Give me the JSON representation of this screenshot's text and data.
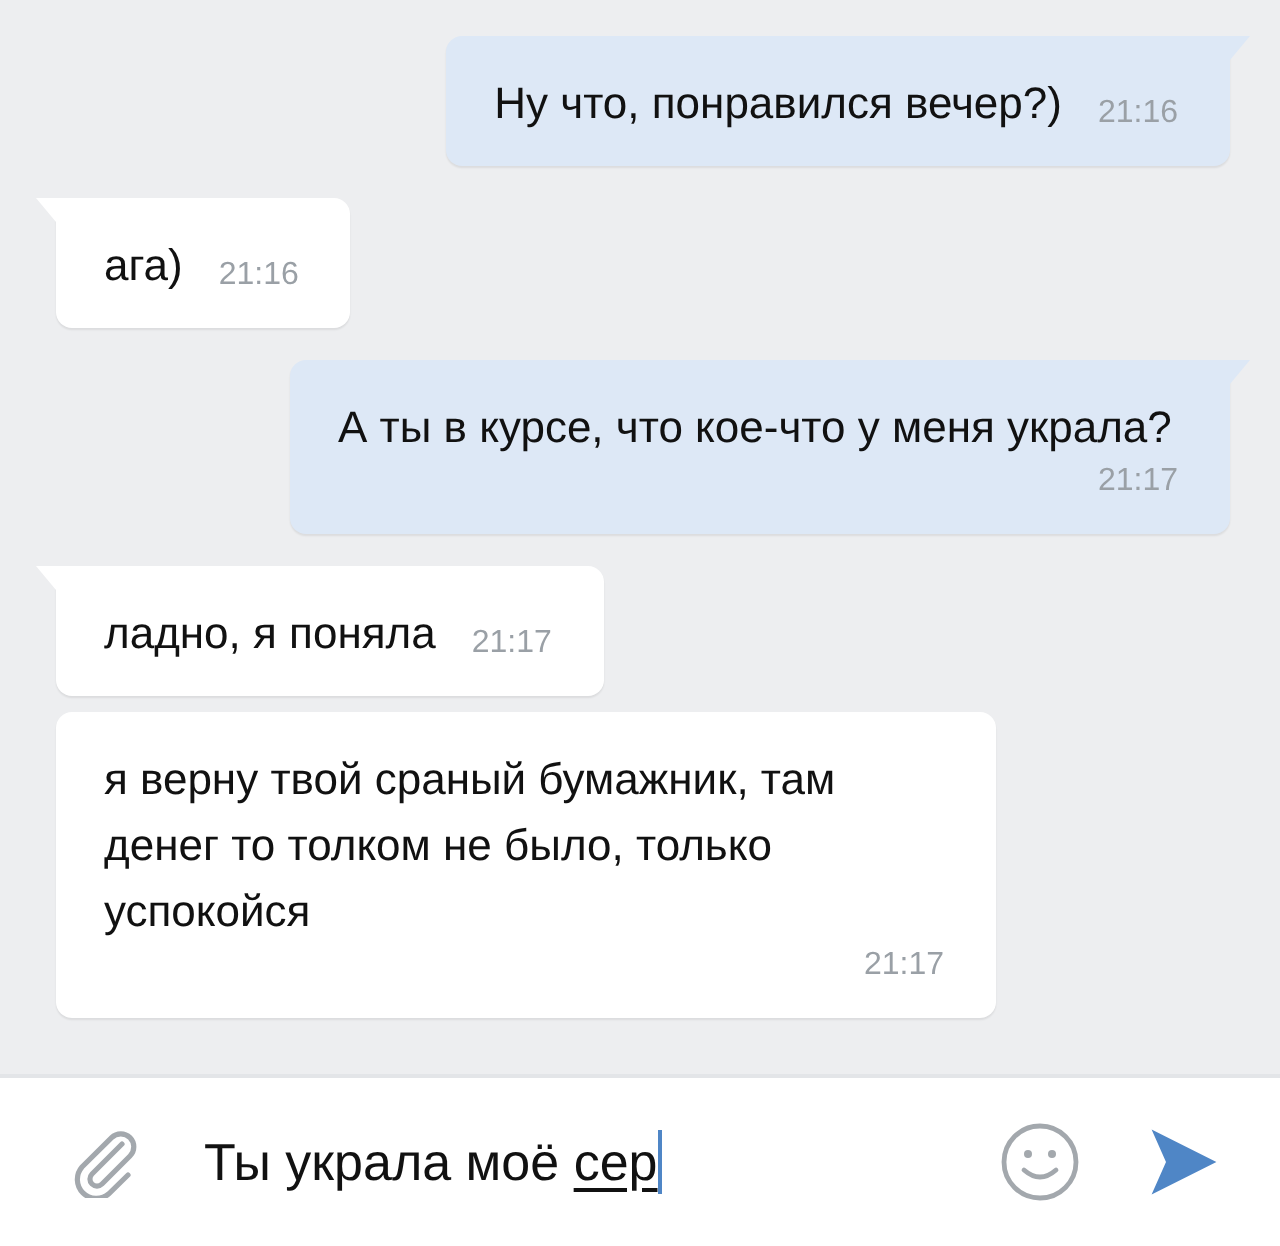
{
  "messages": [
    {
      "kind": "out",
      "tail": true,
      "text": "Ну что, понравился вечер?)",
      "time": "21:16"
    },
    {
      "kind": "in",
      "tail": true,
      "text": "ага)",
      "time": "21:16"
    },
    {
      "kind": "out",
      "tail": true,
      "text": "А ты в курсе, что кое-что у меня украла?",
      "time": "21:17"
    },
    {
      "kind": "in",
      "tail": true,
      "text": "ладно, я поняла",
      "time": "21:17"
    },
    {
      "kind": "in",
      "tail": false,
      "text": "я верну твой сраный бумажник, там денег то толком не было, только успокойся",
      "time": "21:17"
    }
  ],
  "composer": {
    "value": "Ты украла моё ",
    "composing": "сер"
  }
}
